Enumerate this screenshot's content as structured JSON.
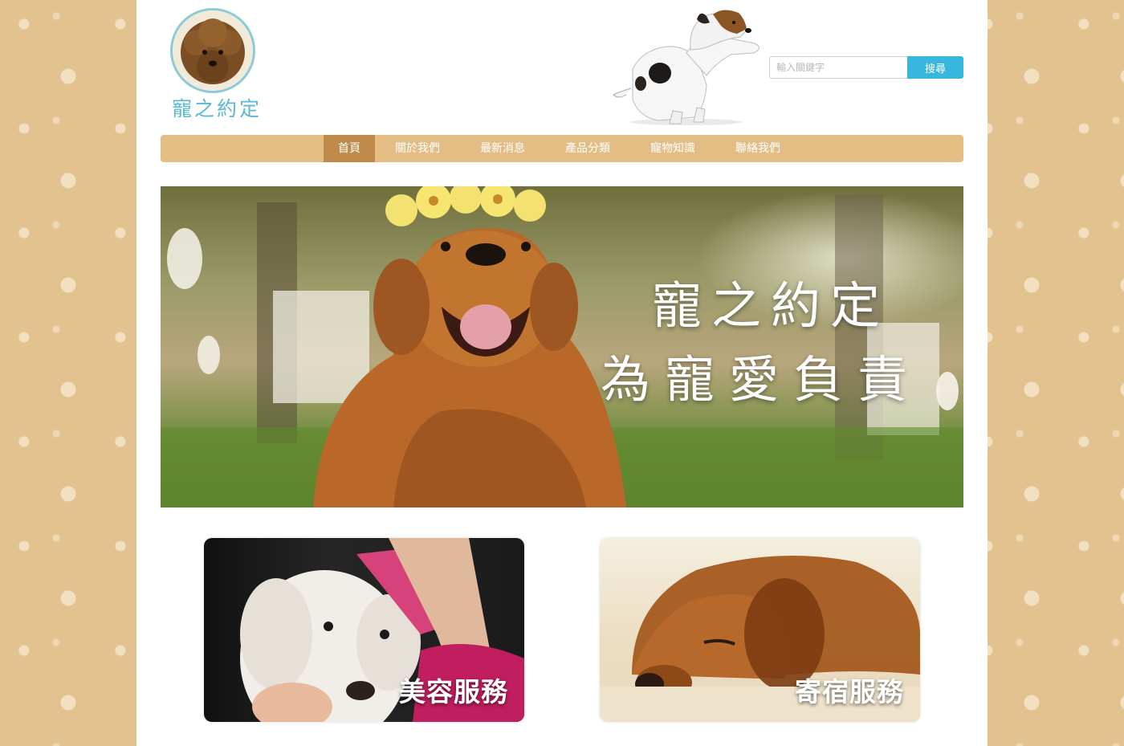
{
  "header": {
    "logo_title": "寵之約定",
    "search_placeholder": "輸入關鍵字",
    "search_button": "搜尋"
  },
  "nav": {
    "items": [
      {
        "label": "首頁",
        "active": true
      },
      {
        "label": "關於我們",
        "active": false
      },
      {
        "label": "最新消息",
        "active": false
      },
      {
        "label": "產品分類",
        "active": false
      },
      {
        "label": "寵物知識",
        "active": false
      },
      {
        "label": "聯絡我們",
        "active": false
      }
    ]
  },
  "banner": {
    "line1": "寵之約定",
    "line2": "為寵愛負責"
  },
  "cards": [
    {
      "label": "美容服務"
    },
    {
      "label": "寄宿服務"
    }
  ],
  "colors": {
    "accent": "#37b6de",
    "nav_bg": "#e4bd85",
    "nav_active": "#c08a4b",
    "page_bg": "#e2c38f",
    "logo_text": "#5bb8d3"
  }
}
